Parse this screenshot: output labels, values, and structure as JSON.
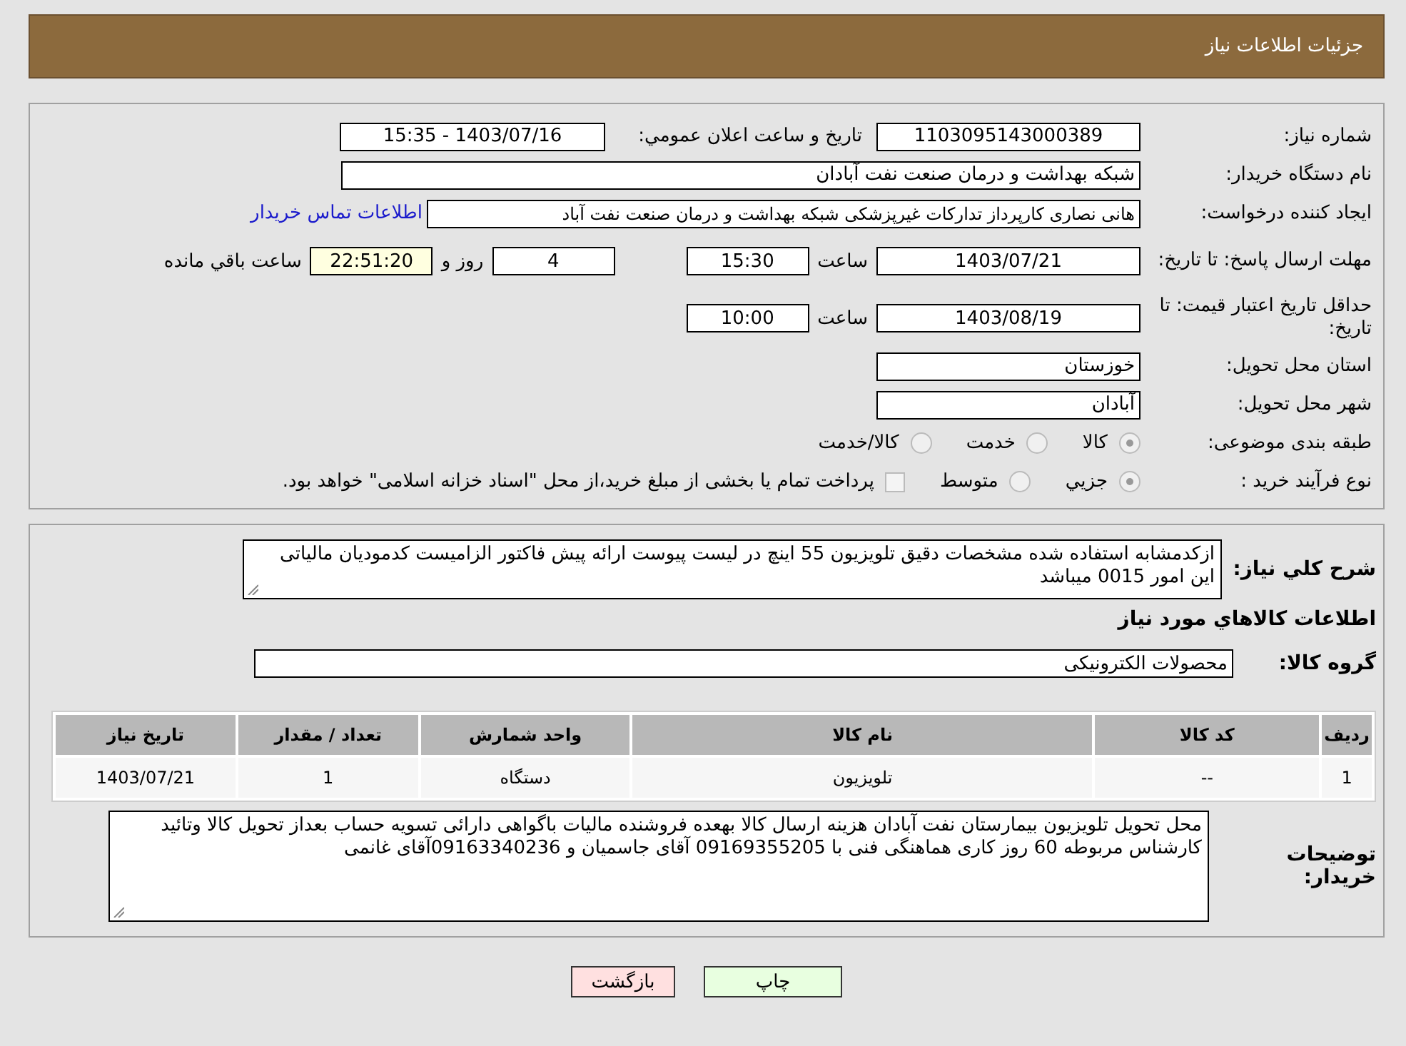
{
  "header": {
    "title": "جزئیات اطلاعات نیاز"
  },
  "need_number": {
    "label": "شماره نیاز:",
    "value": "1103095143000389"
  },
  "announce": {
    "label": "تاریخ و ساعت اعلان عمومي:",
    "value": "1403/07/16 - 15:35"
  },
  "buyer": {
    "label": "نام دستگاه خریدار:",
    "value": "شبکه بهداشت و درمان صنعت نفت آبادان"
  },
  "creator": {
    "label": "ایجاد کننده درخواست:",
    "value": "هانی نصاری کارپرداز تدارکات غیرپزشکی شبکه بهداشت و درمان صنعت نفت آباد",
    "link": "اطلاعات تماس خریدار"
  },
  "deadline": {
    "label": "مهلت ارسال پاسخ: تا تاریخ:",
    "date": "1403/07/21",
    "time_label": "ساعت",
    "time": "15:30",
    "days": "4",
    "days_label": "روز و",
    "remaining": "22:51:20",
    "remaining_label": "ساعت باقي مانده"
  },
  "validity": {
    "label": "حداقل تاریخ اعتبار قیمت: تا تاریخ:",
    "date": "1403/08/19",
    "time_label": "ساعت",
    "time": "10:00"
  },
  "province": {
    "label": "استان محل تحویل:",
    "value": "خوزستان"
  },
  "city": {
    "label": "شهر محل تحویل:",
    "value": "آبادان"
  },
  "category": {
    "label": "طبقه بندی موضوعی:",
    "options": [
      {
        "kind": "radio",
        "label": "کالا",
        "selected": true
      },
      {
        "kind": "radio",
        "label": "خدمت",
        "selected": false
      },
      {
        "kind": "radio",
        "label": "کالا/خدمت",
        "selected": false
      }
    ]
  },
  "process": {
    "label": "نوع فرآیند خرید :",
    "options": [
      {
        "kind": "radio",
        "label": "جزيي",
        "selected": true
      },
      {
        "kind": "radio",
        "label": "متوسط",
        "selected": false
      },
      {
        "kind": "checkbox",
        "label": "پرداخت تمام یا بخشی از مبلغ خرید،از محل \"اسناد خزانه اسلامی\" خواهد بود.",
        "selected": false
      }
    ]
  },
  "description": {
    "label": "شرح كلي نياز:",
    "value": "ازکدمشابه استفاده شده مشخصات دقیق تلویزیون 55 اینچ در لیست پیوست ارائه پیش فاکتور الزامیست کدمودیان مالیاتی این امور 0015 میباشد"
  },
  "goods_title": "اطلاعات كالاهاي مورد نياز",
  "group": {
    "label": "گروه كالا:",
    "value": "محصولات الکترونیکی"
  },
  "table": {
    "columns": [
      "رديف",
      "کد کالا",
      "نام کالا",
      "واحد شمارش",
      "تعداد / مقدار",
      "تاریخ نیاز"
    ],
    "rows": [
      [
        "1",
        "--",
        "تلویزیون",
        "دستگاه",
        "1",
        "1403/07/21"
      ]
    ]
  },
  "notes": {
    "label": "توضیحات خریدار:",
    "value": "محل تحویل تلویزیون بیمارستان نفت آبادان هزینه ارسال کالا بهعده فروشنده مالیات باگواهی دارائی  تسویه حساب بعداز تحویل کالا وتائید کارشناس مربوطه 60 روز کاری هماهنگی فنی با 09169355205 آقای جاسمیان و 09163340236آقای غانمی"
  },
  "buttons": [
    {
      "kind": "print",
      "label": "چاپ"
    },
    {
      "kind": "back",
      "label": "بازگشت"
    }
  ]
}
